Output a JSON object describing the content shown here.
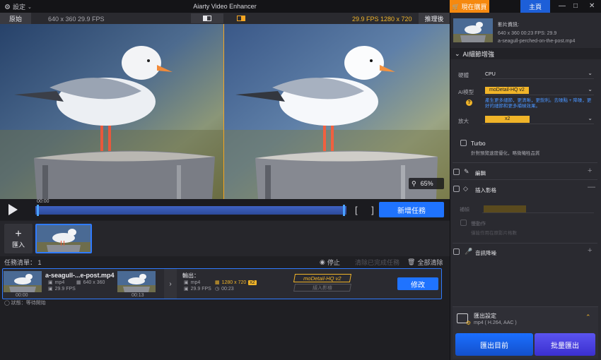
{
  "window": {
    "settings_label": "設定",
    "title": "Aiarty Video Enhancer",
    "purchase_label": "現在購買",
    "home_label": "主頁"
  },
  "preview": {
    "original_label": "原始",
    "original_info": "640 x 360  29.9 FPS",
    "processed_info": "29.9 FPS  1280 x 720",
    "processed_label": "推理後",
    "zoom_value": "65%"
  },
  "playbar": {
    "time_label": "00:00",
    "add_task_label": "新增任務"
  },
  "import": {
    "import_label": "匯入"
  },
  "tasks": {
    "count_label": "任務清單：",
    "count": "1",
    "stop_label": "停止",
    "clear_done_label": "清除已完成任務",
    "clear_all_label": "全部清除",
    "item": {
      "name": "a-seagull-...e-post.mp4",
      "format": "mp4",
      "resolution": "640 x 360",
      "fps": "29.9 FPS",
      "thumb_time_left": "00:00",
      "thumb_time_right": "00:13",
      "output_label": "輸出：",
      "out_format": "mp4",
      "out_resolution": "1280 x 720",
      "out_scale": "x2",
      "out_fps": "29.9 FPS",
      "out_duration": "00:23",
      "model_chip": "moDetail-HQ  v2",
      "enhance_chip": "插入影格",
      "modify_label": "修改",
      "status": "狀態：等待開始"
    }
  },
  "right_panel": {
    "file_info_title": "影片資訊:",
    "file_info_line": "640 x 360  00:23  FPS: 29.9",
    "file_name": "a-seagull-perched-on-the-post.mp4",
    "ai_section_title": "AI細節增強",
    "device_label": "硬體",
    "device_value": "CPU",
    "model_label": "AI模型",
    "model_value": "moDetail-HQ  v2",
    "model_note": "產生更多細節，更清晰，更銳利。去噪點 + 降噪，更好的細節和更多補幀效果。",
    "scale_label": "放大",
    "scale_value": "x2",
    "turbo_label": "Turbo",
    "turbo_note": "針對預覽速度優化，略微犧牲品質",
    "edit_label": "編輯",
    "frame_label": "插入影格",
    "frame_sub_label": "補幀",
    "frame_sub2_label": "慢動作",
    "frame_sub2_note": "僅能作用在原影片格數",
    "audio_label": "音訊降噪",
    "export_settings_title": "匯出設定",
    "export_settings_value": "mp4 ( H.264, AAC )",
    "export_button": "匯出目前",
    "batch_button": "批量匯出"
  },
  "colors": {
    "accent_blue": "#1f73ff",
    "accent_orange": "#f5890f",
    "highlight_yellow": "#f0b429",
    "batch_purple": "#4b42e0"
  }
}
